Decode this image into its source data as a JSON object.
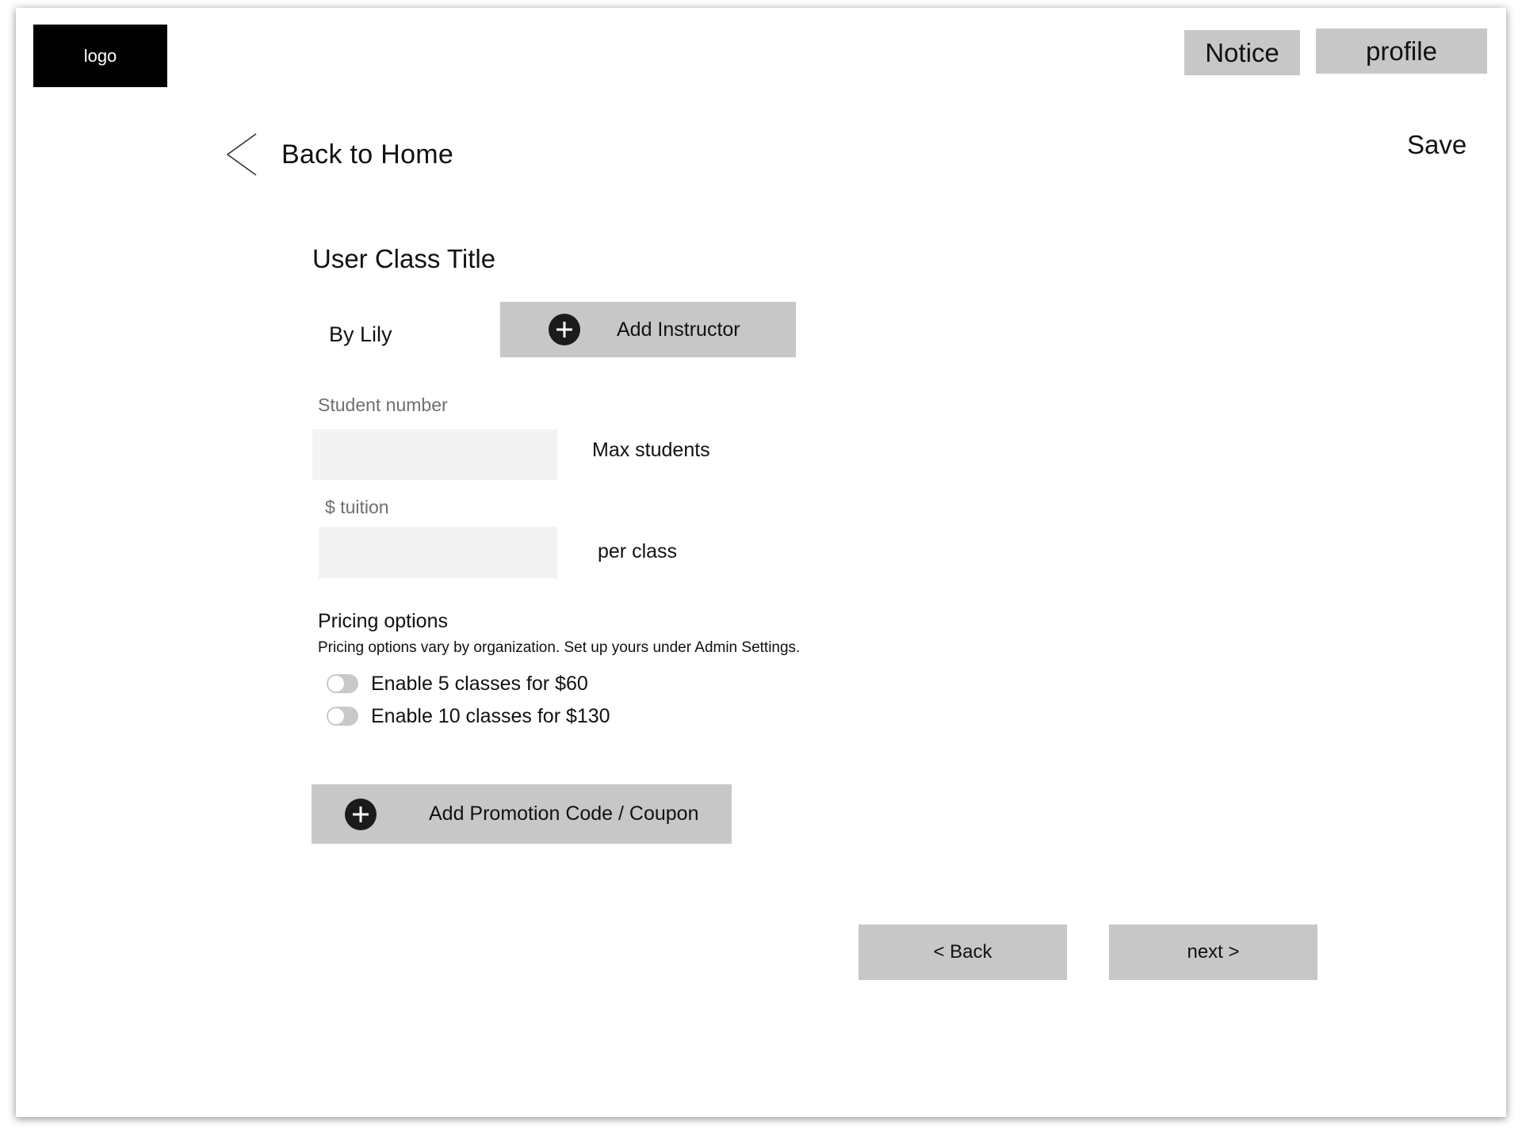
{
  "header": {
    "logo_text": "logo",
    "notice_label": "Notice",
    "profile_label": "profile"
  },
  "nav": {
    "back_home_label": "Back to Home",
    "save_label": "Save"
  },
  "class": {
    "title": "User Class Title",
    "by_line": "By Lily",
    "add_instructor_label": "Add Instructor"
  },
  "fields": {
    "student_number_label": "Student number",
    "student_number_value": "",
    "max_students_label": "Max students",
    "tuition_label": "$ tuition",
    "tuition_value": "",
    "per_class_label": "per class"
  },
  "pricing": {
    "title": "Pricing options",
    "description": "Pricing options vary by organization. Set up yours under Admin Settings.",
    "options": [
      {
        "label": "Enable 5 classes for $60",
        "enabled": false
      },
      {
        "label": "Enable 10 classes for $130",
        "enabled": false
      }
    ]
  },
  "promo": {
    "add_label": "Add Promotion Code / Coupon"
  },
  "footer": {
    "back_label": "< Back",
    "next_label": "next >"
  },
  "colors": {
    "button_gray": "#c7c7c7",
    "input_bg": "#f3f3f3",
    "logo_bg": "#000000",
    "toggle_off": "#c9c9c9"
  },
  "icons": {
    "back": "chevron-left-icon",
    "add": "plus-circle-icon"
  }
}
